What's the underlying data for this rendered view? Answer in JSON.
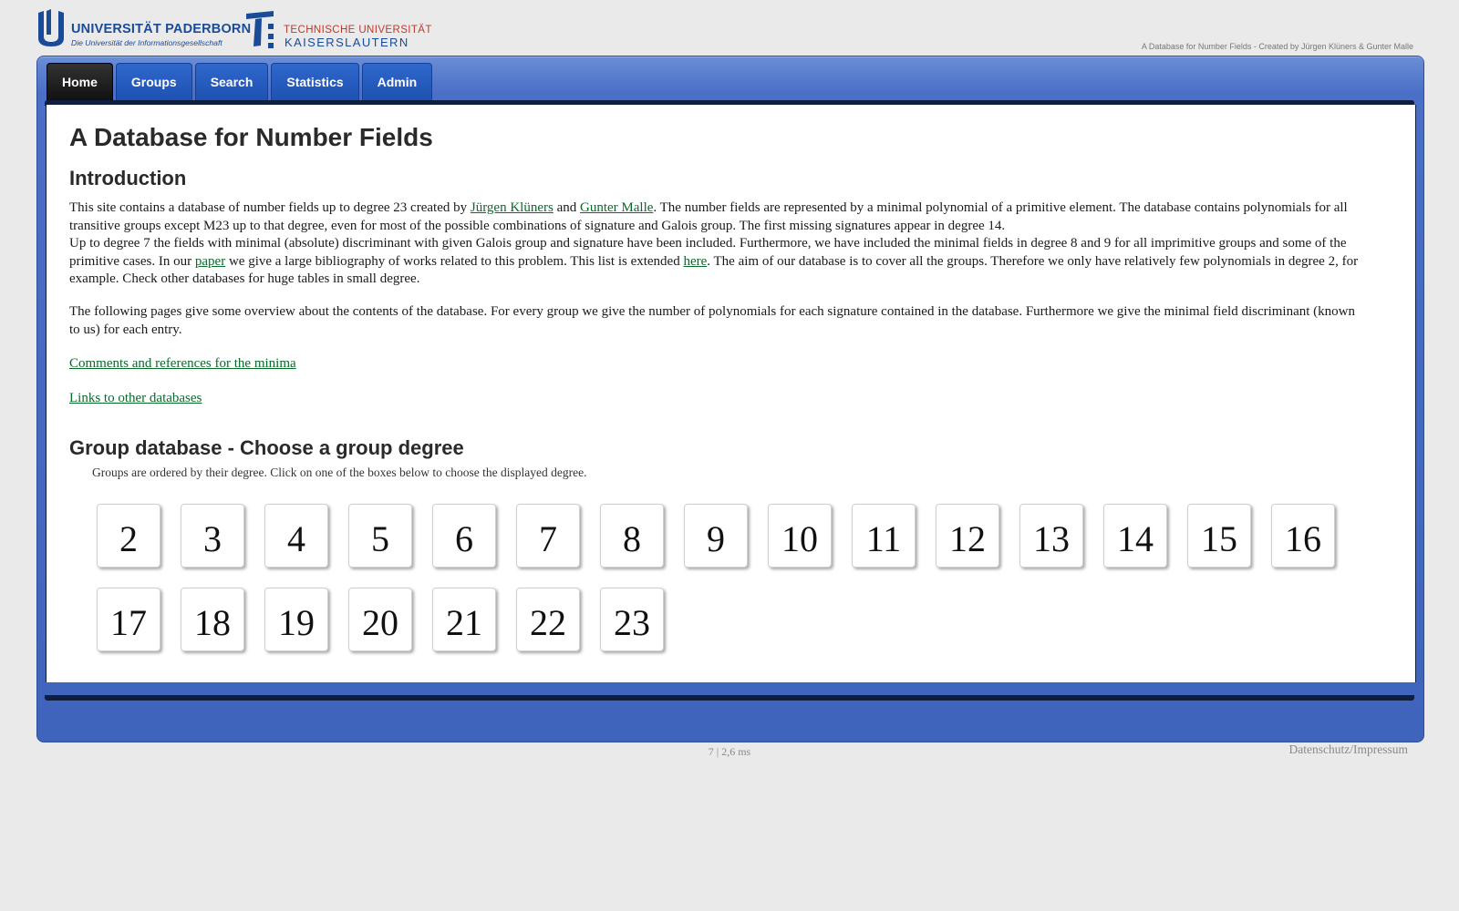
{
  "header": {
    "upb_name": "UNIVERSITÄT PADERBORN",
    "upb_sub": "Die Universität der Informationsgesellschaft",
    "tu_line1": "TECHNISCHE UNIVERSITÄT",
    "tu_line2": "KAISERSLAUTERN",
    "tagline": "A Database for Number Fields - Created by Jürgen Klüners & Gunter Malle"
  },
  "nav": {
    "tabs": [
      {
        "label": "Home",
        "active": true
      },
      {
        "label": "Groups"
      },
      {
        "label": "Search"
      },
      {
        "label": "Statistics"
      },
      {
        "label": "Admin"
      }
    ]
  },
  "main": {
    "title": "A Database for Number Fields",
    "intro_heading": "Introduction",
    "p1": {
      "t1": "This site contains a database of number fields up to degree 23 created by ",
      "link1": "Jürgen Klüners",
      "t2": " and ",
      "link2": "Gunter Malle",
      "t3": ". The number fields are represented by a minimal polynomial of a primitive element. The database contains polynomials for all transitive groups except M23 up to that degree, even for most of the possible combinations of signature and Galois group. The first missing signatures appear in degree 14.",
      "t4": "Up to degree 7 the fields with minimal (absolute) discriminant with given Galois group and signature have been included. Furthermore, we have included the minimal fields in degree 8 and 9 for all imprimitive groups and some of the primitive cases. In our ",
      "link3": "paper",
      "t5": " we give a large bibliography of works related to this problem. This list is extended ",
      "link4": "here",
      "t6": ". The aim of our database is to cover all the groups. Therefore we only have relatively few polynomials in degree 2, for example. Check other databases for huge tables in small degree."
    },
    "p2": "The following pages give some overview about the contents of the database. For every group we give the number of polynomials for each signature contained in the database. Furthermore we give the minimal field discriminant (known to us) for each entry.",
    "link_comments": "Comments and references for the minima",
    "link_other": "Links to other databases",
    "group_heading": "Group database - Choose a group degree",
    "group_hint": "Groups are ordered by their degree. Click on one of the boxes below to choose the displayed degree.",
    "degrees": [
      "2",
      "3",
      "4",
      "5",
      "6",
      "7",
      "8",
      "9",
      "10",
      "11",
      "12",
      "13",
      "14",
      "15",
      "16",
      "17",
      "18",
      "19",
      "20",
      "21",
      "22",
      "23"
    ]
  },
  "footer": {
    "stats": "7   |   2,6 ms",
    "link": "Datenschutz/Impressum"
  },
  "colors": {
    "frame_blue": "#4a6fc6",
    "tab_blue": "#1e52b2",
    "link_green": "#0a6a2a",
    "upb_blue": "#1a4b99",
    "tu_red": "#c0392b"
  }
}
